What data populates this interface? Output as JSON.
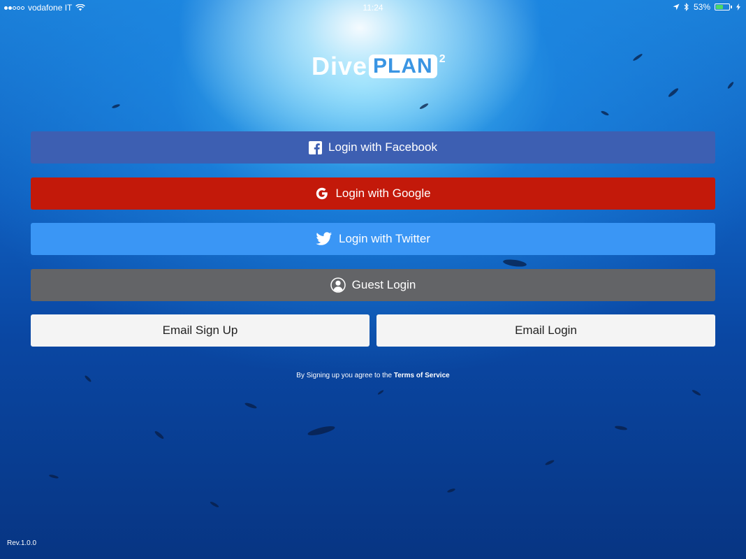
{
  "status_bar": {
    "carrier": "vodafone IT",
    "time": "11:24",
    "battery": "53%",
    "battery_level": 0.53,
    "signal_bars": 2,
    "signal_total": 5
  },
  "logo": {
    "dive": "Dive",
    "plan": "PLAN",
    "superscript": "2"
  },
  "buttons": {
    "facebook": {
      "label": "Login with Facebook",
      "icon": "facebook-icon",
      "color": "#3d5fb2"
    },
    "google": {
      "label": "Login with Google",
      "icon": "google-icon",
      "color": "#c3190a"
    },
    "twitter": {
      "label": "Login with Twitter",
      "icon": "twitter-icon",
      "color": "#3a96f5"
    },
    "guest": {
      "label": "Guest Login",
      "icon": "user-icon",
      "color": "#636467"
    },
    "email_signup": {
      "label": "Email Sign Up"
    },
    "email_login": {
      "label": "Email Login"
    }
  },
  "terms": {
    "prefix": "By Signing up you agree to the",
    "link": "Terms of Service"
  },
  "revision": "Rev.1.0.0"
}
